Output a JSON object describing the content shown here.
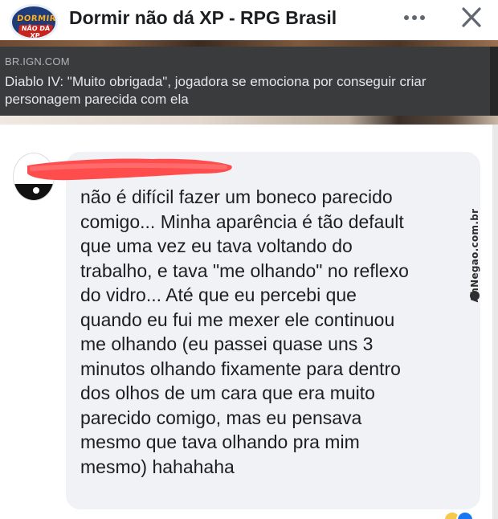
{
  "header": {
    "group_name": "Dormir não dá XP - RPG Brasil",
    "logo_text_top": "DORMIR",
    "logo_text_bottom": "NÃO DÁ XP",
    "more_icon": "more-horizontal-icon",
    "close_icon": "close-icon"
  },
  "link_preview": {
    "domain": "BR.IGN.COM",
    "title": "Diablo IV: \"Muito obrigada\", jogadora se emociona por conseguir criar personagem parecida com ela"
  },
  "comment": {
    "author_name_redacted": true,
    "text": "não é difícil fazer um boneco parecido\ncomigo... Minha aparência é tão default\nque uma vez eu tava voltando do\ntrabalho, e tava \"me olhando\" no reflexo\ndo vidro... Até que eu percebi que\nquando eu fui me mexer ele continuou\nme olhando (eu passei quase uns 3\nminutos olhando fixamente para dentro\ndos olhos de um cara que era muito\nparecido comigo, mas eu pensava\nmesmo que tava olhando pra mim\nmesmo) hahahaha",
    "reactions": [
      "haha",
      "like"
    ]
  },
  "watermark": {
    "text": "AhNegao.com.br"
  },
  "colors": {
    "header_title": "#1c1e21",
    "link_panel": "#3a3b3c",
    "link_title": "#e4e6eb",
    "link_domain": "#b0b3b8",
    "bubble": "#f0f2f5",
    "redaction": "#ff4d4d",
    "like_blue": "#1877f2",
    "haha_yellow": "#f7c94b"
  }
}
